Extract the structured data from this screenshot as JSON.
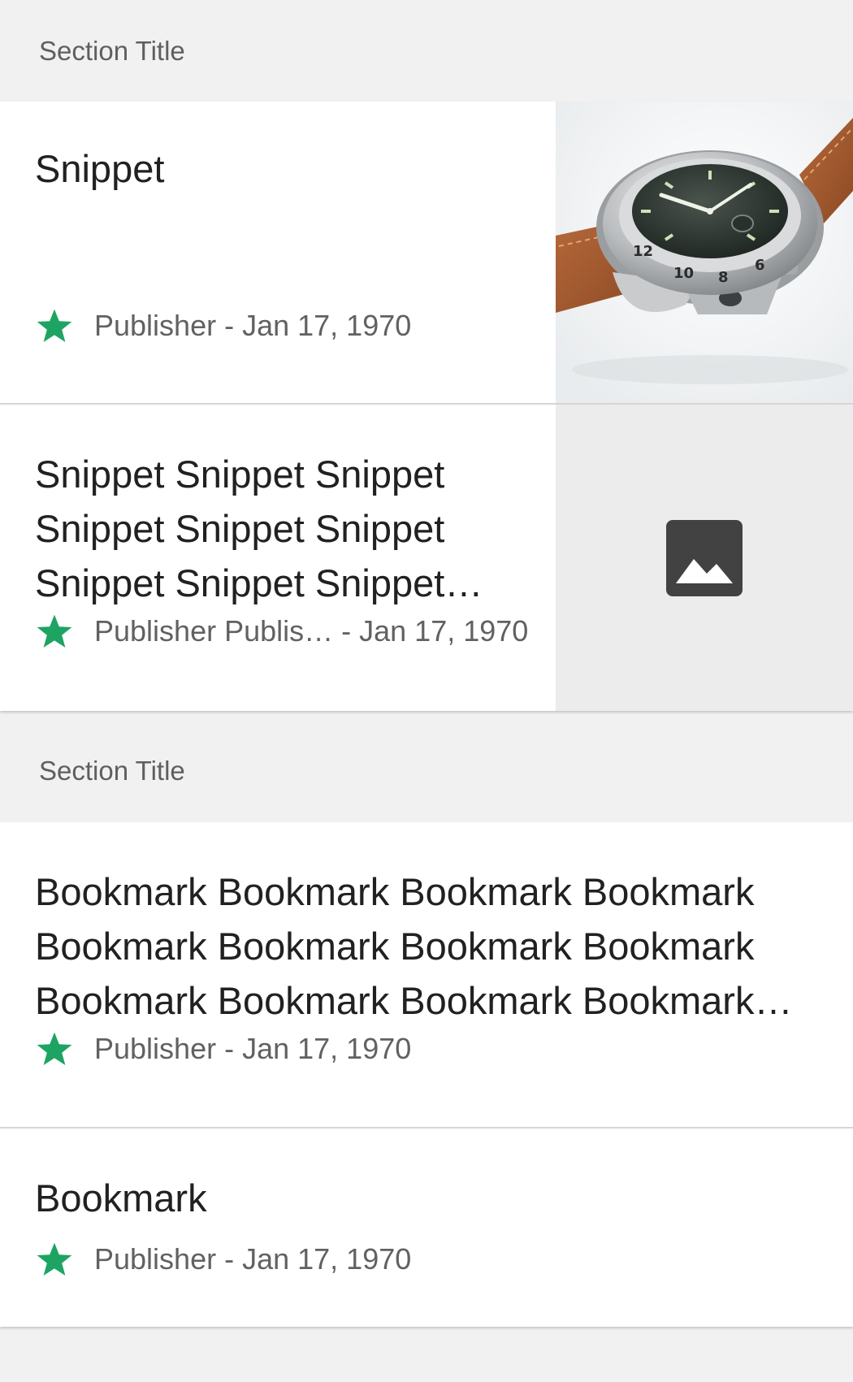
{
  "sections": [
    {
      "title": "Section Title",
      "cards": [
        {
          "snippet": "Snippet",
          "meta": "Publisher - Jan 17, 1970",
          "thumbnail": "watch-photo"
        },
        {
          "snippet": "Snippet Snippet Snippet Snippet Snippet Snippet Snippet Snippet Snippet…",
          "meta": "Publisher Publis… - Jan 17, 1970",
          "thumbnail": "image-placeholder-icon"
        }
      ]
    },
    {
      "title": "Section Title",
      "cards": [
        {
          "snippet": "Bookmark Bookmark Bookmark Bookmark Bookmark Bookmark Bookmark Bookmark Bookmark Bookmark Bookmark Bookmark…",
          "meta": "Publisher - Jan 17, 1970"
        },
        {
          "snippet": "Bookmark",
          "meta": "Publisher - Jan 17, 1970"
        }
      ]
    }
  ],
  "colors": {
    "star": "#1da462",
    "background": "#f1f1f1",
    "card": "#ffffff",
    "title_text": "#212121",
    "meta_text": "#616161"
  },
  "icons": [
    "star-icon",
    "image-placeholder-icon"
  ]
}
